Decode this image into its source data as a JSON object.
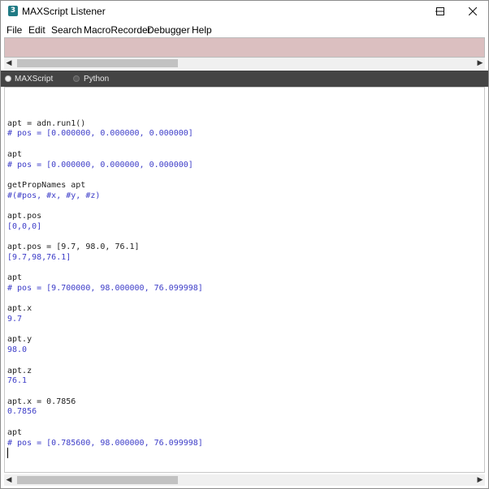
{
  "window": {
    "title": "MAXScript Listener",
    "icon_letter": "3"
  },
  "menu": [
    "File",
    "Edit",
    "Search",
    "MacroRecorder",
    "Debugger",
    "Help"
  ],
  "tabs": [
    {
      "label": "MAXScript",
      "selected": true
    },
    {
      "label": "Python",
      "selected": false
    }
  ],
  "colors": {
    "history_bg": "#dbbfc0",
    "tabbar_bg": "#444444",
    "input_text": "#222222",
    "output_text": "#3d3dc8"
  },
  "listener_lines": [
    {
      "text": "",
      "kind": "in"
    },
    {
      "text": "apt = adn.run1()",
      "kind": "in"
    },
    {
      "text": "# pos = [0.000000, 0.000000, 0.000000]",
      "kind": "out"
    },
    {
      "text": "",
      "kind": "in"
    },
    {
      "text": "apt",
      "kind": "in"
    },
    {
      "text": "# pos = [0.000000, 0.000000, 0.000000]",
      "kind": "out"
    },
    {
      "text": "",
      "kind": "in"
    },
    {
      "text": "getPropNames apt",
      "kind": "in"
    },
    {
      "text": "#(#pos, #x, #y, #z)",
      "kind": "out"
    },
    {
      "text": "",
      "kind": "in"
    },
    {
      "text": "apt.pos",
      "kind": "in"
    },
    {
      "text": "[0,0,0]",
      "kind": "out"
    },
    {
      "text": "",
      "kind": "in"
    },
    {
      "text": "apt.pos = [9.7, 98.0, 76.1]",
      "kind": "in"
    },
    {
      "text": "[9.7,98,76.1]",
      "kind": "out"
    },
    {
      "text": "",
      "kind": "in"
    },
    {
      "text": "apt",
      "kind": "in"
    },
    {
      "text": "# pos = [9.700000, 98.000000, 76.099998]",
      "kind": "out"
    },
    {
      "text": "",
      "kind": "in"
    },
    {
      "text": "apt.x",
      "kind": "in"
    },
    {
      "text": "9.7",
      "kind": "out"
    },
    {
      "text": "",
      "kind": "in"
    },
    {
      "text": "apt.y",
      "kind": "in"
    },
    {
      "text": "98.0",
      "kind": "out"
    },
    {
      "text": "",
      "kind": "in"
    },
    {
      "text": "apt.z",
      "kind": "in"
    },
    {
      "text": "76.1",
      "kind": "out"
    },
    {
      "text": "",
      "kind": "in"
    },
    {
      "text": "apt.x = 0.7856",
      "kind": "in"
    },
    {
      "text": "0.7856",
      "kind": "out"
    },
    {
      "text": "",
      "kind": "in"
    },
    {
      "text": "apt",
      "kind": "in"
    },
    {
      "text": "# pos = [0.785600, 98.000000, 76.099998]",
      "kind": "out"
    }
  ]
}
